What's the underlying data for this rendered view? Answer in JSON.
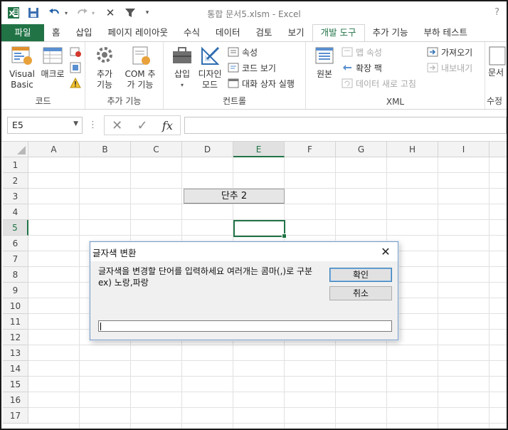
{
  "window": {
    "title": "통합 문서5.xlsm - Excel",
    "help": "?"
  },
  "qat": {
    "icons": [
      "excel-logo-icon",
      "save-icon",
      "undo-icon",
      "redo-icon",
      "clear-icon",
      "filter-icon",
      "customize-qat-icon"
    ]
  },
  "tabs": [
    "파일",
    "홈",
    "삽입",
    "페이지 레이아웃",
    "수식",
    "데이터",
    "검토",
    "보기",
    "개발 도구",
    "추가 기능",
    "부하 테스트"
  ],
  "active_tab": "개발 도구",
  "ribbon": {
    "code": {
      "label": "코드",
      "visual_basic": "Visual Basic",
      "macros": "매크로"
    },
    "addins": {
      "label": "추가 기능",
      "addins": "추가 기능",
      "com_addins": "COM 추가 기능"
    },
    "controls": {
      "label": "컨트롤",
      "insert": "삽입",
      "design_mode": "디자인 모드",
      "properties": "속성",
      "view_code": "코드 보기",
      "run_dialog": "대화 상자 실행"
    },
    "xml": {
      "label": "XML",
      "source": "원본",
      "map_properties": "맵 속성",
      "expansion_packs": "확장 팩",
      "refresh_data": "데이터 새로 고침",
      "import": "가져오기",
      "export": "내보내기"
    },
    "modify": {
      "label": "수정",
      "document_panel": "문서 패"
    }
  },
  "formula_bar": {
    "name_box": "E5",
    "separator": "⋮",
    "cancel": "✕",
    "enter": "✓",
    "fx": "fx",
    "content": ""
  },
  "grid": {
    "columns": [
      "A",
      "B",
      "C",
      "D",
      "E",
      "F",
      "G",
      "H",
      "I"
    ],
    "rows": [
      "1",
      "2",
      "3",
      "4",
      "5",
      "6",
      "7",
      "8",
      "9",
      "10",
      "11",
      "12",
      "13",
      "14",
      "15",
      "16",
      "17"
    ],
    "selected_column": "E",
    "selected_row": "5",
    "form_button_label": "단추 2"
  },
  "dialog": {
    "title": "글자색 변환",
    "message": "글자색을 변경할 단어를 입력하세요 여러개는 콤마(,)로 구분 ex) 노랑,파랑",
    "ok": "확인",
    "cancel": "취소",
    "input_value": ""
  },
  "colors": {
    "excel_green": "#217346",
    "dialog_bg": "#f0f0f0"
  }
}
